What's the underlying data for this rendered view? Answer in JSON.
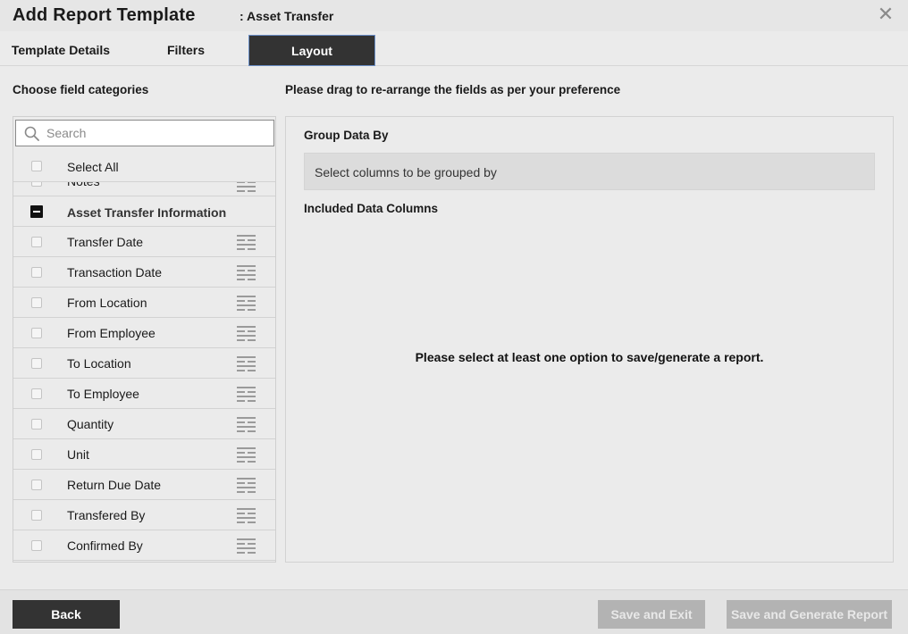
{
  "header": {
    "title": "Add Report Template",
    "subtitle": ": Asset Transfer",
    "close_symbol": "✕"
  },
  "tabs": [
    {
      "label": "Template Details"
    },
    {
      "label": "Filters"
    },
    {
      "label": "Layout",
      "active": true
    }
  ],
  "left": {
    "heading": "Choose field categories",
    "search_placeholder": "Search",
    "select_all": "Select All",
    "partial_item": "Notes",
    "category": "Asset Transfer Information",
    "fields": [
      "Transfer Date",
      "Transaction Date",
      "From Location",
      "From Employee",
      "To Location",
      "To Employee",
      "Quantity",
      "Unit",
      "Return Due Date",
      "Transfered By",
      "Confirmed By"
    ]
  },
  "right": {
    "instruction": "Please drag to re-arrange the fields as per your preference",
    "group_heading": "Group Data By",
    "group_placeholder": "Select columns to be grouped by",
    "included_heading": "Included Data Columns",
    "empty_message": "Please select at least one option to save/generate a report."
  },
  "footer": {
    "back": "Back",
    "save_exit": "Save and Exit",
    "save_generate": "Save and Generate Report"
  },
  "colors": {
    "dark": "#333333",
    "disabled": "#b3b3b3",
    "active_tab_border": "#6a8ec6"
  }
}
